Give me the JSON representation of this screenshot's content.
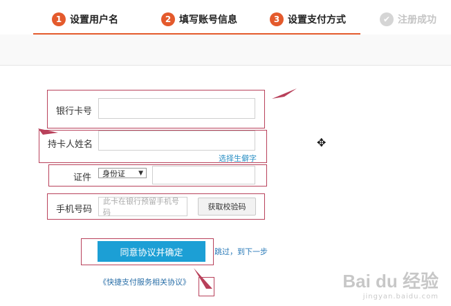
{
  "steps": [
    {
      "num": "1",
      "label": "设置用户名"
    },
    {
      "num": "2",
      "label": "填写账号信息"
    },
    {
      "num": "3",
      "label": "设置支付方式"
    },
    {
      "num": "✔",
      "label": "注册成功"
    }
  ],
  "form": {
    "bank_card_label": "银行卡号",
    "bank_card_value": "",
    "holder_name_label": "持卡人姓名",
    "holder_name_value": "",
    "rare_char_link": "选择生僻字",
    "id_label": "证件",
    "id_type_selected": "身份证",
    "id_number_value": "",
    "phone_label": "手机号码",
    "phone_placeholder": "此卡在银行预留手机号码",
    "get_code_button": "获取校验码"
  },
  "actions": {
    "agree_button": "同意协议并确定",
    "skip_link": "跳过，到下一步",
    "protocol_link": "《快捷支付服务相关协议》"
  },
  "colors": {
    "accent": "#e45a2c",
    "primary_button": "#1c9fd5",
    "annotation": "#b8405a"
  },
  "watermark": {
    "main": "Bai du 经验",
    "sub": "jingyan.baidu.com"
  }
}
